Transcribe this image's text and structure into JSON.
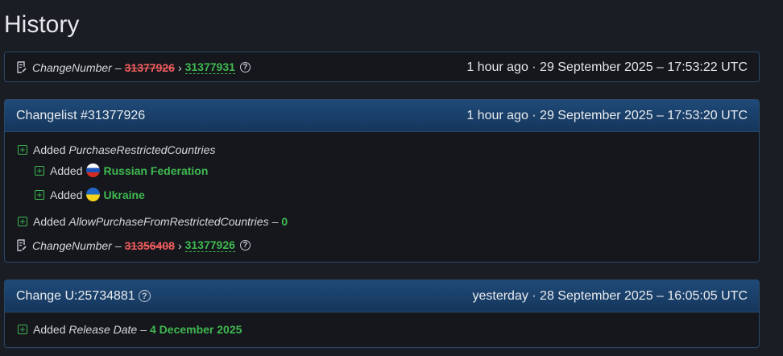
{
  "page_title": "History",
  "entry1": {
    "field": "ChangeNumber",
    "dash": "–",
    "old_value": "31377926",
    "arrow": "›",
    "new_value": "31377931",
    "time": "1 hour ago · 29 September 2025 – 17:53:22 UTC"
  },
  "changelist": {
    "title": "Changelist #31377926",
    "time": "1 hour ago · 29 September 2025 – 17:53:20 UTC",
    "items": [
      {
        "action": "Added",
        "field": "PurchaseRestrictedCountries"
      },
      {
        "action": "Added",
        "value": "Russian Federation",
        "flag": "russia-flag-icon"
      },
      {
        "action": "Added",
        "value": "Ukraine",
        "flag": "ukraine-flag-icon"
      },
      {
        "action": "Added",
        "field": "AllowPurchaseFromRestrictedCountries",
        "dash": "–",
        "value": "0"
      }
    ],
    "change": {
      "field": "ChangeNumber",
      "dash": "–",
      "old_value": "31356408",
      "arrow": "›",
      "new_value": "31377926"
    }
  },
  "change_u": {
    "title": "Change U:25734881",
    "time": "yesterday · 28 September 2025 – 16:05:05 UTC",
    "item": {
      "action": "Added",
      "field": "Release Date",
      "dash": "–",
      "value": "4 December 2025"
    }
  },
  "colors": {
    "background": "#1a1d24",
    "header": "#1f4a78",
    "added": "#3fb950",
    "removed": "#f05d5d"
  }
}
